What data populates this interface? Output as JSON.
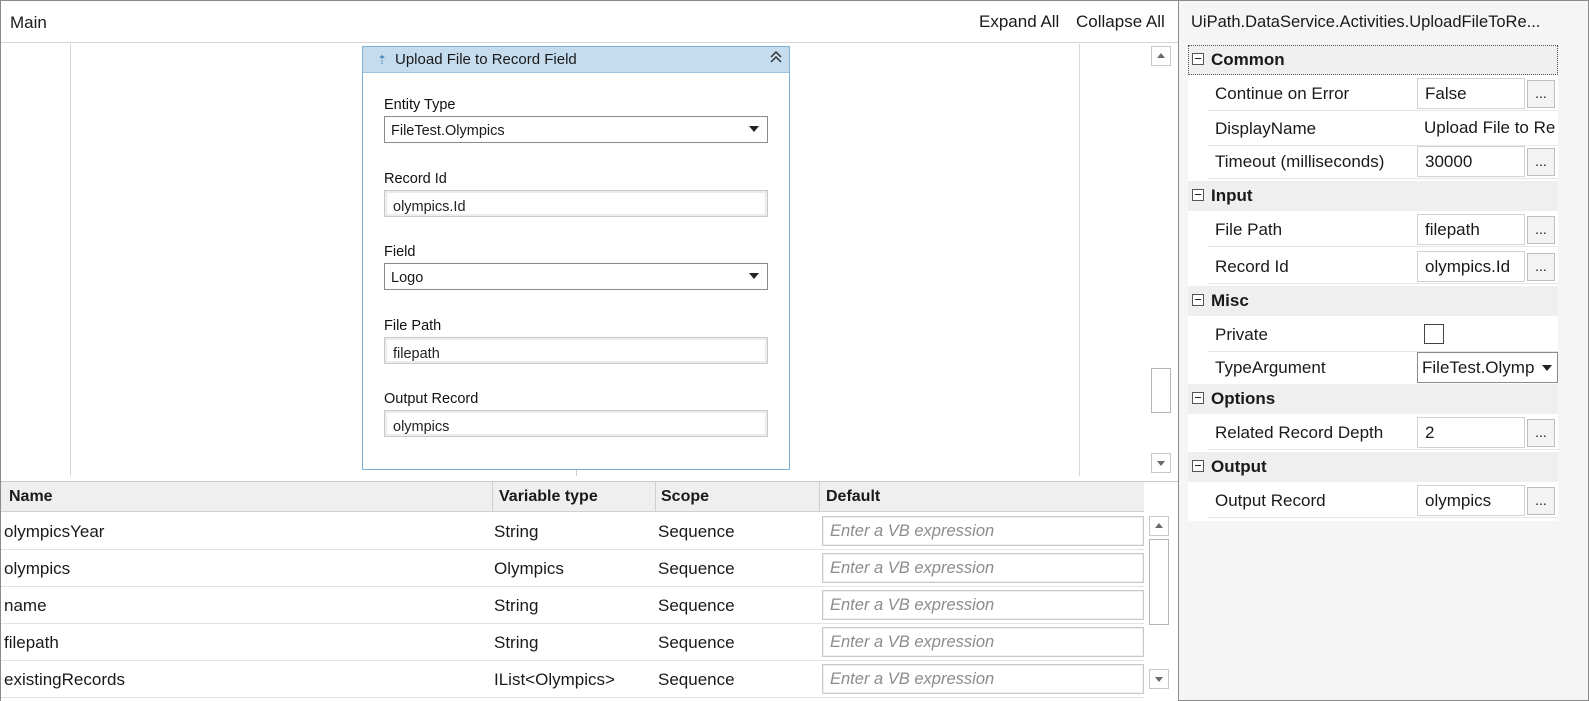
{
  "designer": {
    "breadcrumb": "Main",
    "expand_all": "Expand All",
    "collapse_all": "Collapse All"
  },
  "activity": {
    "title": "Upload File to Record Field",
    "pin_icon": "pin-icon",
    "collapse_icon": "double-chevron-up-icon",
    "fields": {
      "entity_type": {
        "label": "Entity Type",
        "value": "FileTest.Olympics"
      },
      "record_id": {
        "label": "Record Id",
        "value": "olympics.Id"
      },
      "field": {
        "label": "Field",
        "value": "Logo"
      },
      "file_path": {
        "label": "File Path",
        "value": "filepath"
      },
      "output_record": {
        "label": "Output Record",
        "value": "olympics"
      }
    }
  },
  "variables": {
    "headers": {
      "name": "Name",
      "type": "Variable type",
      "scope": "Scope",
      "default": "Default"
    },
    "rows": [
      {
        "name": "olympicsYear",
        "type": "String",
        "scope": "Sequence",
        "default_placeholder": "Enter a VB expression"
      },
      {
        "name": "olympics",
        "type": "Olympics",
        "scope": "Sequence",
        "default_placeholder": "Enter a VB expression"
      },
      {
        "name": "name",
        "type": "String",
        "scope": "Sequence",
        "default_placeholder": "Enter a VB expression"
      },
      {
        "name": "filepath",
        "type": "String",
        "scope": "Sequence",
        "default_placeholder": "Enter a VB expression"
      },
      {
        "name": "existingRecords",
        "type": "IList<Olympics>",
        "scope": "Sequence",
        "default_placeholder": "Enter a VB expression"
      }
    ]
  },
  "properties": {
    "title": "UiPath.DataService.Activities.UploadFileToRe...",
    "ellipsis": "...",
    "categories": {
      "common": {
        "name": "Common",
        "continue_on_error": {
          "label": "Continue on Error",
          "value": "False"
        },
        "display_name": {
          "label": "DisplayName",
          "value": "Upload File to Re"
        },
        "timeout": {
          "label": "Timeout (milliseconds)",
          "value": "30000"
        }
      },
      "input": {
        "name": "Input",
        "file_path": {
          "label": "File Path",
          "value": "filepath"
        },
        "record_id": {
          "label": "Record Id",
          "value": "olympics.Id"
        }
      },
      "misc": {
        "name": "Misc",
        "private": {
          "label": "Private",
          "checked": false
        },
        "type_argument": {
          "label": "TypeArgument",
          "value": "FileTest.Olymp"
        }
      },
      "options": {
        "name": "Options",
        "related_record_depth": {
          "label": "Related Record Depth",
          "value": "2"
        }
      },
      "output": {
        "name": "Output",
        "output_record": {
          "label": "Output Record",
          "value": "olympics"
        }
      }
    }
  }
}
